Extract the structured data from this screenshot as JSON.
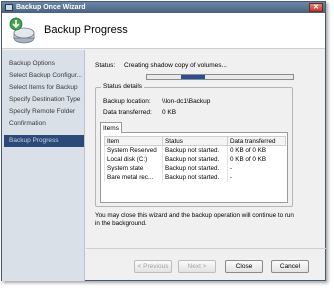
{
  "window": {
    "title": "Backup Once Wizard"
  },
  "header": {
    "title": "Backup Progress"
  },
  "sidebar": {
    "items": [
      {
        "label": "Backup Options"
      },
      {
        "label": "Select Backup Configur..."
      },
      {
        "label": "Select Items for Backup"
      },
      {
        "label": "Specify Destination Type"
      },
      {
        "label": "Specify Remote Folder"
      },
      {
        "label": "Confirmation"
      },
      {
        "label": "Backup Progress"
      }
    ],
    "active_index": 6
  },
  "status": {
    "label": "Status:",
    "value": "Creating shadow copy of volumes..."
  },
  "details": {
    "legend": "Status details",
    "location_label": "Backup location:",
    "location_value": "\\\\lon-dc1\\Backup",
    "transferred_label": "Data transferred:",
    "transferred_value": "0 KB"
  },
  "tab": {
    "label": "Items"
  },
  "table": {
    "headers": [
      "Item",
      "Status",
      "Data transferred"
    ],
    "rows": [
      [
        "System Reserved",
        "Backup not started.",
        "0 KB of 0 KB"
      ],
      [
        "Local disk (C:)",
        "Backup not started.",
        "0 KB of 0 KB"
      ],
      [
        "System state",
        "Backup not started.",
        "-"
      ],
      [
        "Bare metal rec...",
        "Backup not started.",
        "-"
      ]
    ]
  },
  "note": "You may close this wizard and the backup operation will continue to run in the background.",
  "buttons": {
    "previous": "< Previous",
    "next": "Next >",
    "close": "Close",
    "cancel": "Cancel"
  },
  "colors": {
    "accent": "#2b4a7a",
    "progress": "#2a4f95"
  }
}
